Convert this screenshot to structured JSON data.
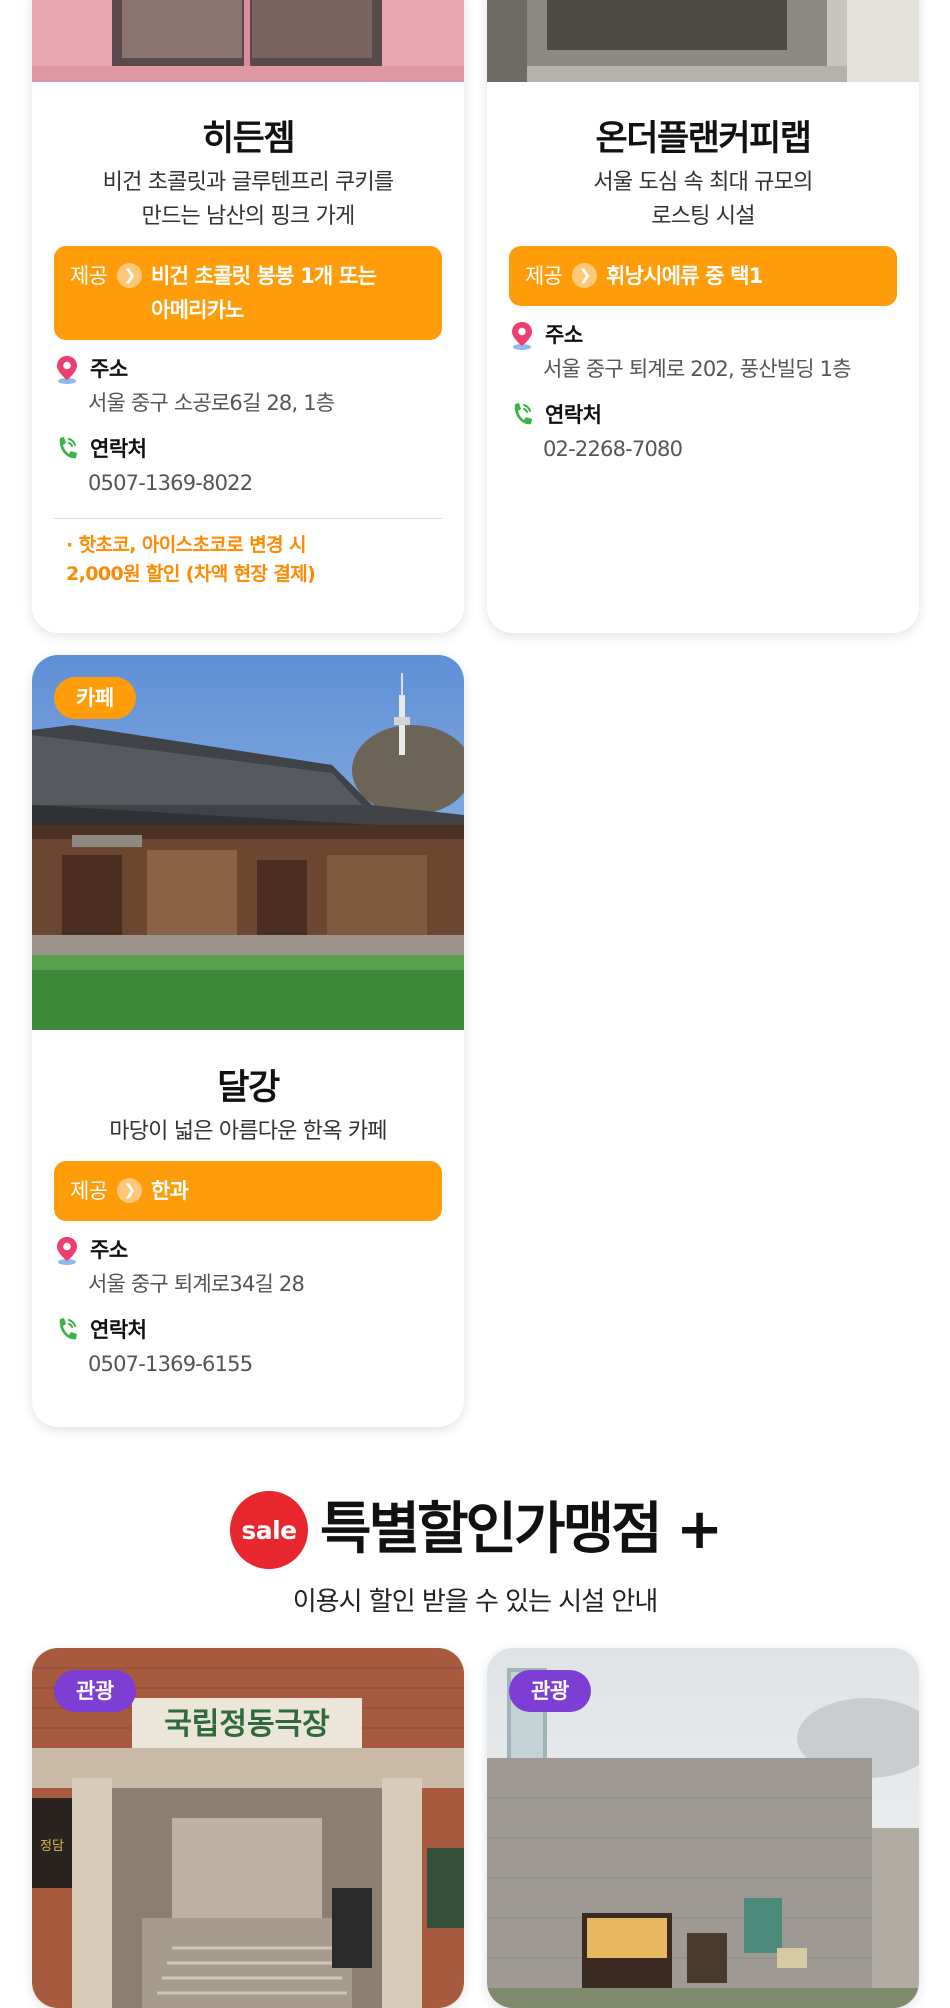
{
  "cards": [
    {
      "title": "히든젬",
      "desc": "비건 초콜릿과 글루텐프리 쿠키를\n만드는 남산의 핑크 가게",
      "offer_label": "제공",
      "offer_text": "비건 초콜릿 봉봉 1개 또는\n아메리카노",
      "address_label": "주소",
      "address": "서울 중구 소공로6길 28, 1층",
      "contact_label": "연락처",
      "contact": "0507-1369-8022",
      "note": "· 핫초코, 아이스초코로 변경 시\n  2,000원 할인 (차액 현장 결제)"
    },
    {
      "title": "온더플랜커피랩",
      "desc": "서울 도심 속 최대 규모의\n로스팅 시설",
      "offer_label": "제공",
      "offer_text": "휘낭시에류 중 택1",
      "address_label": "주소",
      "address": "서울 중구 퇴계로 202, 풍산빌딩 1층",
      "contact_label": "연락처",
      "contact": "02-2268-7080"
    },
    {
      "badge": "카페",
      "title": "달강",
      "desc": "마당이 넓은 아름다운 한옥 카페",
      "offer_label": "제공",
      "offer_text": "한과",
      "address_label": "주소",
      "address": "서울 중구 퇴계로34길 28",
      "contact_label": "연락처",
      "contact": "0507-1369-6155"
    }
  ],
  "section": {
    "sale_badge": "sale",
    "heading": "특별할인가맹점 +",
    "subheading": "이용시 할인 받을 수 있는 시설 안내"
  },
  "bottom_cards": [
    {
      "badge": "관광",
      "sign_text": "국립정동극장",
      "side_sign": "정담"
    },
    {
      "badge": "관광"
    }
  ],
  "colors": {
    "offer": "#ff9c0a",
    "badge_cafe": "#ff9c0a",
    "badge_tour": "#7d3fd3",
    "sale": "#e8262e",
    "note": "#ff8a00"
  },
  "icons": {
    "address": "map-pin-icon",
    "contact": "phone-icon",
    "offer_arrow": "chevron-right-icon"
  }
}
